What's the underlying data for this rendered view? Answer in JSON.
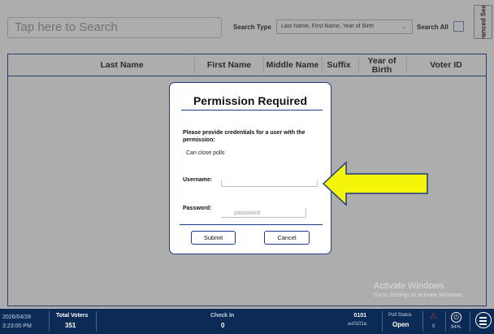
{
  "search": {
    "placeholder": "Tap here to Search"
  },
  "search_type": {
    "label": "Search Type",
    "selected": "Last Name, First Name, Year of Birth"
  },
  "search_all": {
    "label": "Search All",
    "checked": false
  },
  "advanced_search": {
    "label": "Advanced Search"
  },
  "table": {
    "columns": [
      "Last Name",
      "First Name",
      "Middle Name",
      "Suffix",
      "Year of Birth",
      "Voter ID"
    ],
    "rows": []
  },
  "dialog": {
    "title": "Permission Required",
    "message": "Please provide credentials for a user with the permission:",
    "permission": "Can close polls",
    "username_label": "Username:",
    "username_value": "",
    "password_label": "Password:",
    "password_placeholder": "password",
    "submit_label": "Submit",
    "cancel_label": "Cancel"
  },
  "watermark": {
    "line1": "Activate Windows",
    "line2": "Go to Settings to activate Windows."
  },
  "status": {
    "date": "2026/04/28",
    "time": "3:23:00 PM",
    "total_voters_label": "Total Voters",
    "total_voters": "351",
    "check_in_label": "Check In",
    "check_in": "0",
    "precinct_code": "0101",
    "precinct_sub": "uu0101a",
    "poll_status_label": "Poll Status",
    "poll_status": "Open",
    "alert_count": "0",
    "battery": "94%"
  },
  "colors": {
    "navy": "#0b2a55",
    "accent": "#1e3a8a",
    "arrow": "#f5f50a"
  }
}
